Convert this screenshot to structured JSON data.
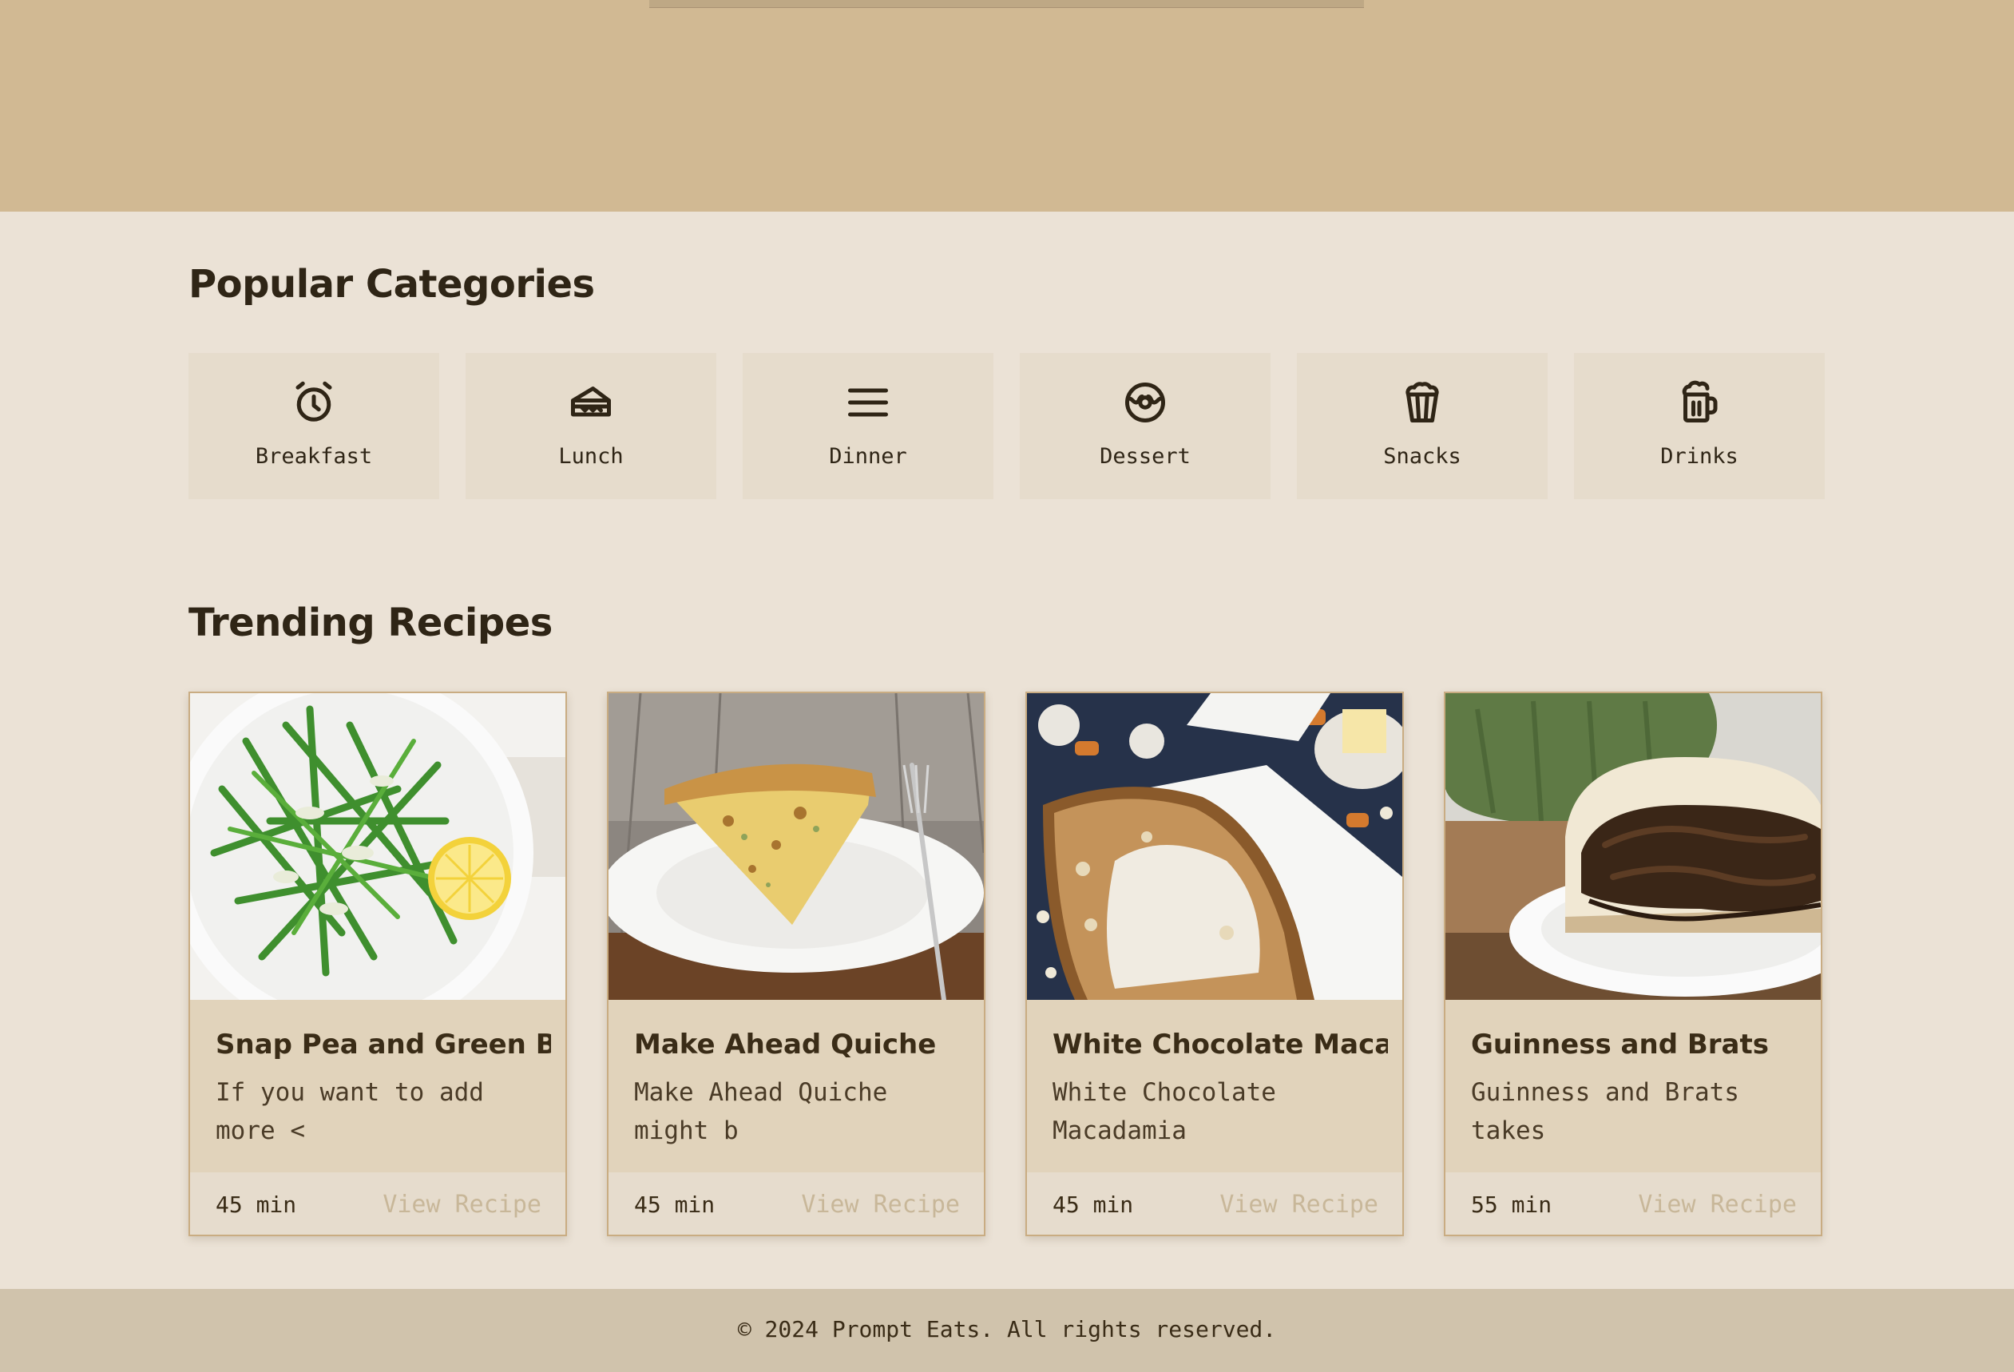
{
  "sections": {
    "categories_title": "Popular Categories",
    "trending_title": "Trending Recipes"
  },
  "categories": [
    {
      "label": "Breakfast",
      "icon": "alarm-clock-icon"
    },
    {
      "label": "Lunch",
      "icon": "sandwich-icon"
    },
    {
      "label": "Dinner",
      "icon": "menu-lines-icon"
    },
    {
      "label": "Dessert",
      "icon": "donut-icon"
    },
    {
      "label": "Snacks",
      "icon": "popcorn-icon"
    },
    {
      "label": "Drinks",
      "icon": "beer-mug-icon"
    }
  ],
  "recipes": [
    {
      "title": "Snap Pea and Green B",
      "desc": "If you want to add more <",
      "time": "45 min",
      "link": "View Recipe"
    },
    {
      "title": "Make Ahead Quiche",
      "desc": "Make Ahead Quiche might b",
      "time": "45 min",
      "link": "View Recipe"
    },
    {
      "title": "White Chocolate Maca",
      "desc": "White Chocolate Macadamia",
      "time": "45 min",
      "link": "View Recipe"
    },
    {
      "title": "Guinness and Brats",
      "desc": "Guinness and Brats takes",
      "time": "55 min",
      "link": "View Recipe"
    }
  ],
  "footer": {
    "text": "© 2024 Prompt Eats. All rights reserved."
  },
  "colors": {
    "hero": "#d1b993",
    "page_bg": "#ebe2d6",
    "card_bg": "#e1d3bb",
    "card_border": "#c9ac82",
    "footer_bg": "#d0c3ac",
    "text": "#2f2516",
    "link_muted": "#c8b799"
  }
}
